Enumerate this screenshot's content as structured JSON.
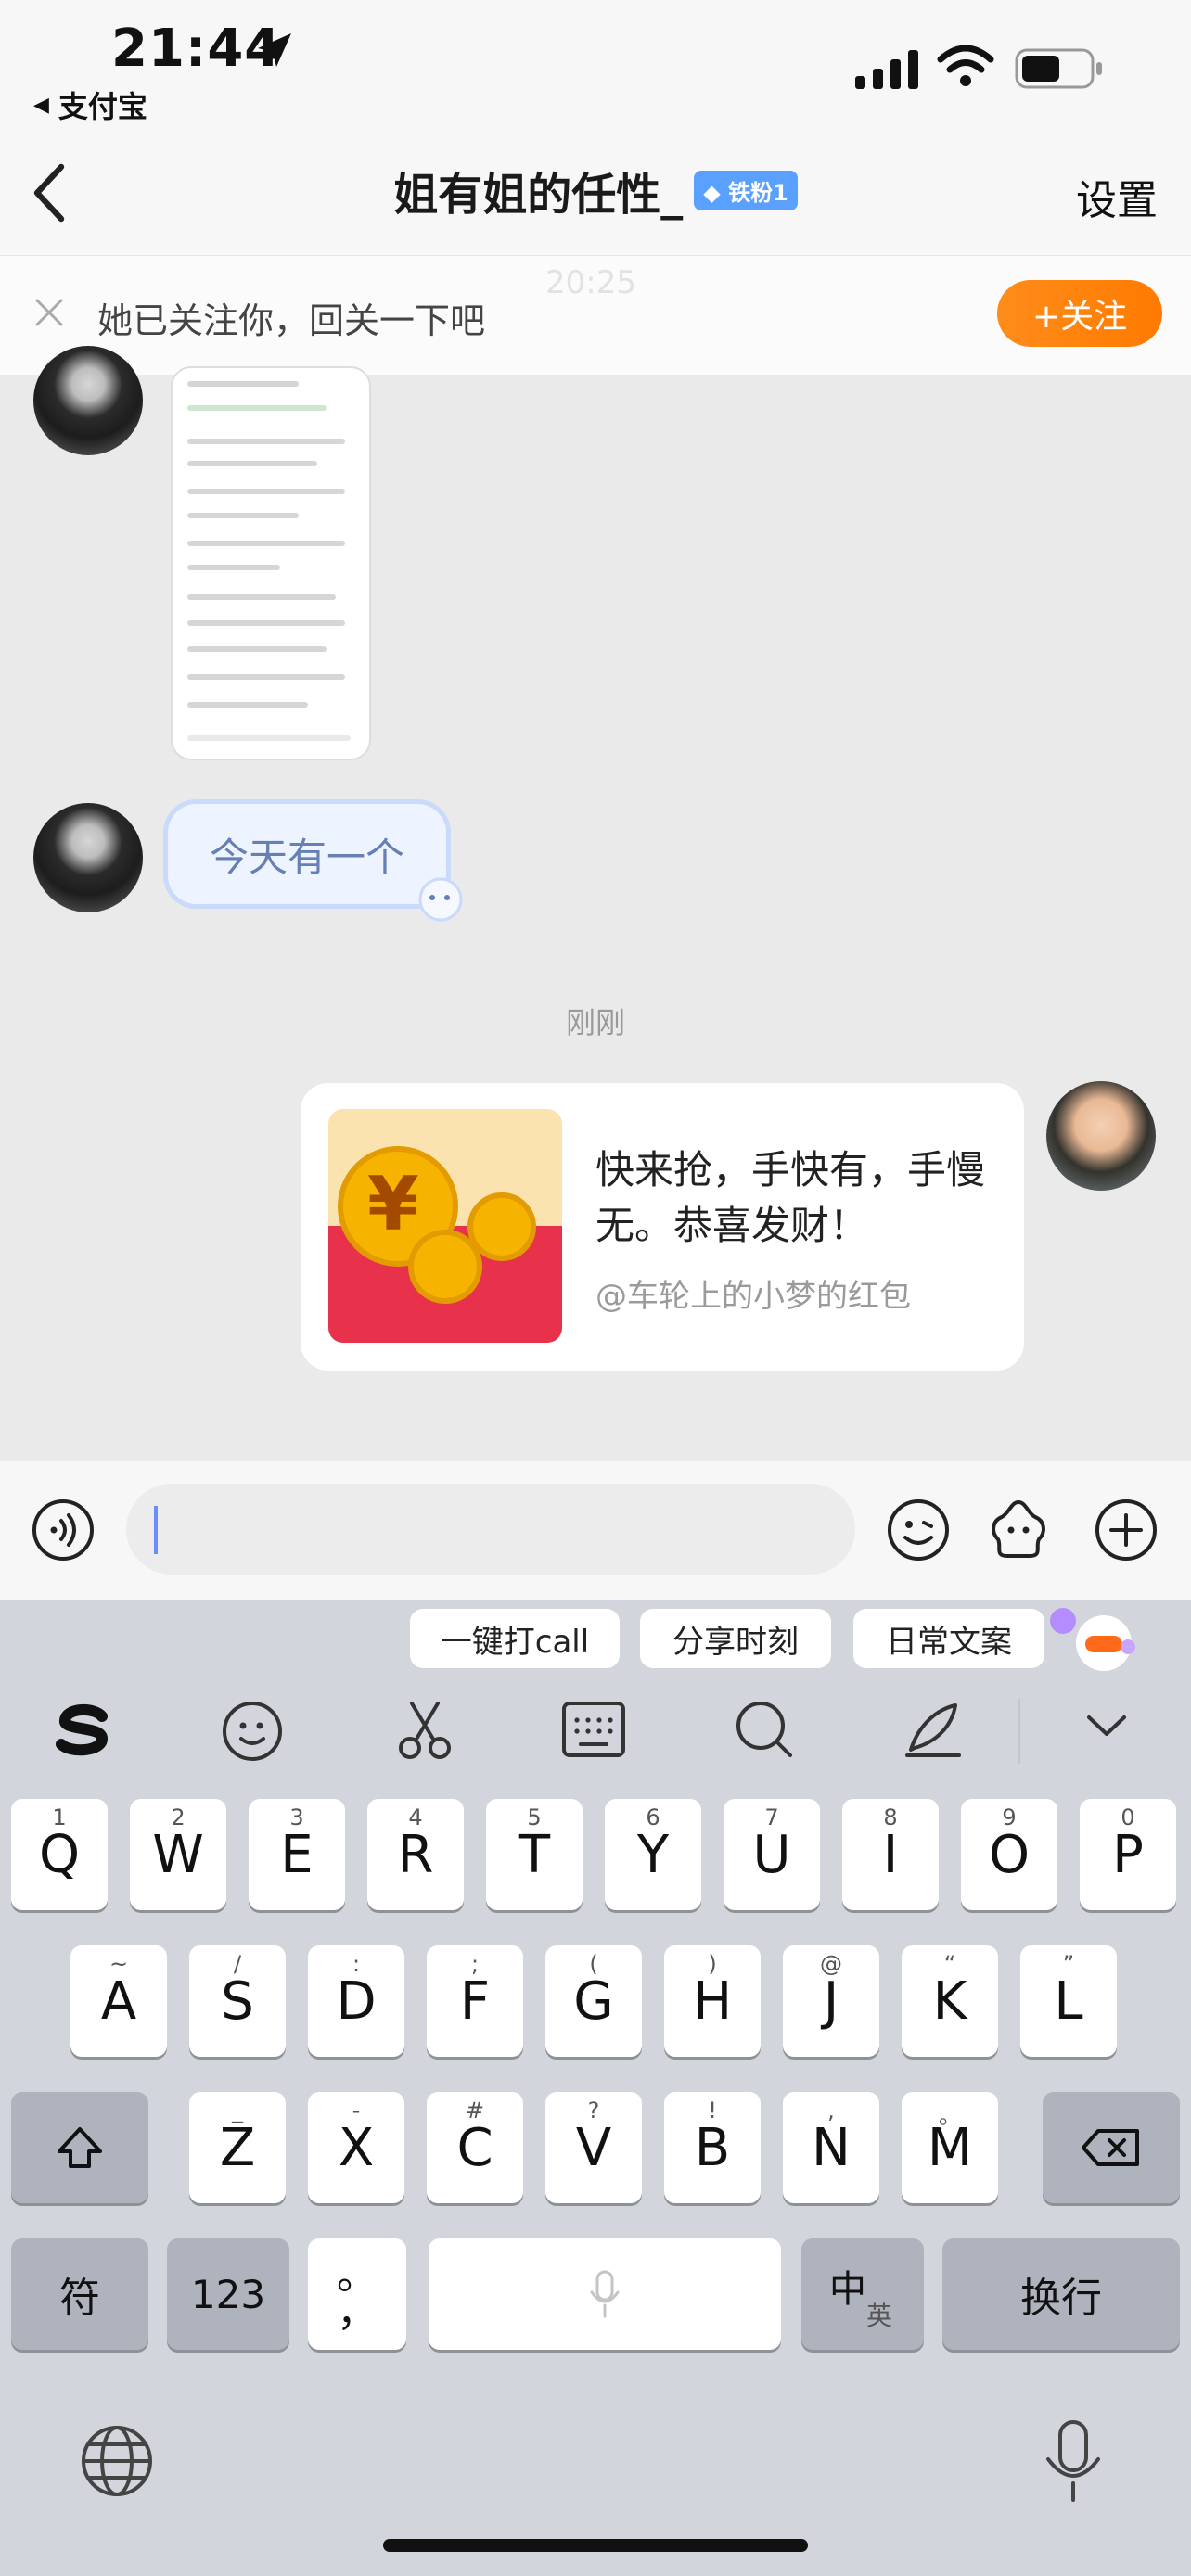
{
  "status_bar": {
    "time": "21:44",
    "back_app": "支付宝"
  },
  "nav": {
    "title": "姐有姐的任性_",
    "badge": "铁粉1",
    "settings": "设置",
    "faded_time": "20:25"
  },
  "follow_bar": {
    "text": "她已关注你，回关一下吧",
    "button": "+关注"
  },
  "messages": {
    "incoming_text": "今天有一个",
    "timestamp": "刚刚",
    "red_packet_title": "快来抢，手快有，手慢无。恭喜发财！",
    "red_packet_sender": "@车轮上的小梦的红包"
  },
  "suggestions": [
    "一键打call",
    "分享时刻",
    "日常文案"
  ],
  "keyboard": {
    "row1": [
      [
        "Q",
        "1"
      ],
      [
        "W",
        "2"
      ],
      [
        "E",
        "3"
      ],
      [
        "R",
        "4"
      ],
      [
        "T",
        "5"
      ],
      [
        "Y",
        "6"
      ],
      [
        "U",
        "7"
      ],
      [
        "I",
        "8"
      ],
      [
        "O",
        "9"
      ],
      [
        "P",
        "0"
      ]
    ],
    "row2": [
      [
        "A",
        "~"
      ],
      [
        "S",
        "/"
      ],
      [
        "D",
        ":"
      ],
      [
        "F",
        ";"
      ],
      [
        "G",
        "("
      ],
      [
        "H",
        ")"
      ],
      [
        "J",
        "@"
      ],
      [
        "K",
        "“"
      ],
      [
        "L",
        "”"
      ]
    ],
    "row3": [
      [
        "Z",
        "_"
      ],
      [
        "X",
        "-"
      ],
      [
        "C",
        "#"
      ],
      [
        "V",
        "?"
      ],
      [
        "B",
        "!"
      ],
      [
        "N",
        ","
      ],
      [
        "M",
        "。"
      ]
    ],
    "fu": "符",
    "num": "123",
    "punct": "。，",
    "punct_hint": "。",
    "punct_main": "，",
    "zh": "中",
    "en": "英",
    "enter": "换行"
  }
}
